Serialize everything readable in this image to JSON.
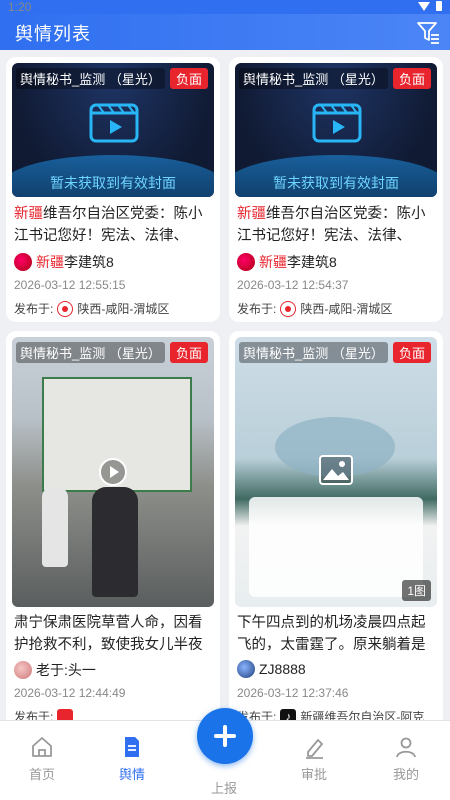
{
  "status_bar": {
    "time": "1:20"
  },
  "app_bar": {
    "title": "舆情列表"
  },
  "cards": [
    {
      "monitor_tag": "舆情秘书_监测 （星光）",
      "badge": "负面",
      "cover_text": "暂未获取到有效封面",
      "text_highlight": "新疆",
      "text_rest": "维吾尔自治区党委：陈小江书记您好！宪法、法律、法...",
      "author_highlight": "新疆",
      "author_rest": "李建筑8",
      "time": "2026-03-12 12:55:15",
      "pub_prefix": "发布于:",
      "pub_place": "陕西-咸阳-渭城区"
    },
    {
      "monitor_tag": "舆情秘书_监测 （星光）",
      "badge": "负面",
      "cover_text": "暂未获取到有效封面",
      "text_highlight": "新疆",
      "text_rest": "维吾尔自治区党委：陈小江书记您好！宪法、法律、法...",
      "author_highlight": "新疆",
      "author_rest": "李建筑8",
      "time": "2026-03-12 12:54:37",
      "pub_prefix": "发布于:",
      "pub_place": "陕西-咸阳-渭城区"
    },
    {
      "monitor_tag": "舆情秘书_监测 （星光）",
      "badge": "负面",
      "text": "肃宁保肃医院草菅人命，因看护抢救不利，致使我女儿半夜被...",
      "author": "老于:头一",
      "time": "2026-03-12 12:44:49",
      "pub_prefix": "发布于:"
    },
    {
      "monitor_tag": "舆情秘书_监测 （星光）",
      "badge": "负面",
      "image_count": "1图",
      "text": "下午四点到的机场凌晨四点起飞的，太雷霆了。原来躺着是这...",
      "author": "ZJ8888",
      "time": "2026-03-12 12:37:46",
      "pub_prefix": "发布于:",
      "pub_place": "新疆维吾尔自治区-阿克"
    }
  ],
  "bottom_nav": {
    "home": "首页",
    "yuqing": "舆情",
    "report": "上报",
    "approve": "审批",
    "me": "我的"
  },
  "colors": {
    "primary": "#2f6ff0",
    "negative": "#e8242d"
  }
}
